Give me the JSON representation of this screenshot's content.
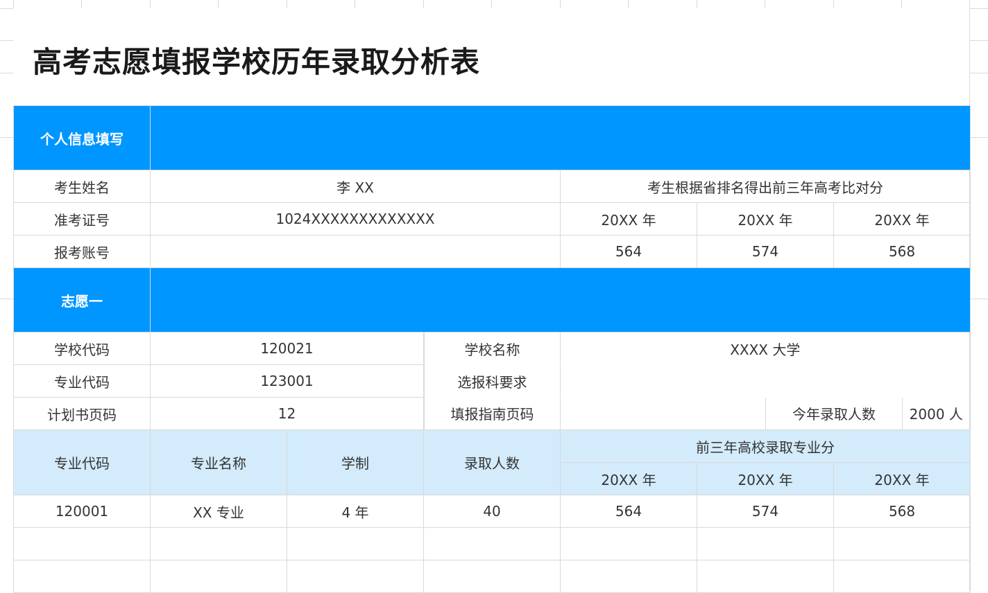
{
  "title": "高考志愿填报学校历年录取分析表",
  "colors": {
    "section_blue": "#0096ff",
    "header_light_blue": "#d3ebfb",
    "grid": "#d9d9d9"
  },
  "personal": {
    "section_label": "个人信息填写",
    "name_label": "考生姓名",
    "name_value": "李 XX",
    "compare_label": "考生根据省排名得出前三年高考比对分",
    "ticket_label": "准考证号",
    "ticket_value": "1024XXXXXXXXXXXXX",
    "years": [
      "20XX 年",
      "20XX 年",
      "20XX 年"
    ],
    "account_label": "报考账号",
    "account_value": "",
    "scores": [
      "564",
      "574",
      "568"
    ]
  },
  "choice1": {
    "section_label": "志愿一",
    "school_code_label": "学校代码",
    "school_code": "120021",
    "school_name_label": "学校名称",
    "school_name": "XXXX 大学",
    "major_code_label": "专业代码",
    "major_code": "123001",
    "subject_req_label": "选报科要求",
    "subject_req": "",
    "plan_page_label": "计划书页码",
    "plan_page": "12",
    "guide_page_label": "填报指南页码",
    "guide_page": "",
    "admit_count_label": "今年录取人数",
    "admit_count": "2000 人"
  },
  "major_table": {
    "headers": {
      "code": "专业代码",
      "name": "专业名称",
      "duration": "学制",
      "admitted": "录取人数",
      "history": "前三年高校录取专业分",
      "years": [
        "20XX 年",
        "20XX 年",
        "20XX 年"
      ]
    },
    "rows": [
      {
        "code": "120001",
        "name": "XX 专业",
        "duration": "4 年",
        "admitted": "40",
        "scores": [
          "564",
          "574",
          "568"
        ]
      }
    ]
  }
}
